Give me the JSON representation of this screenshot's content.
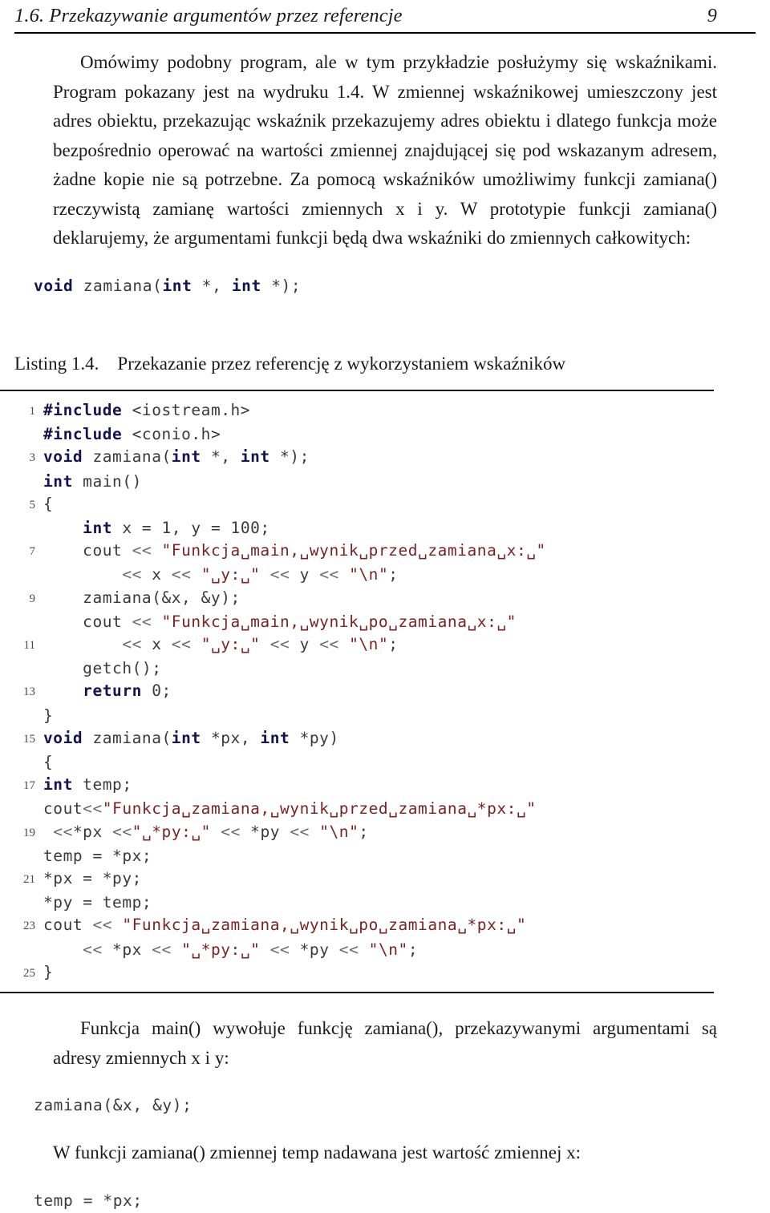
{
  "header": {
    "title": "1.6. Przekazywanie argumentów przez referencje",
    "page_number": "9"
  },
  "paragraphs": {
    "intro": "Omówimy podobny program, ale w tym przykładzie posłużymy się wskaźnikami. Program pokazany jest na wydruku 1.4. W zmiennej wskaźnikowej umieszczony jest adres obiektu, przekazując wskaźnik przekazujemy adres obiektu i dlatego funkcja może bezpośrednio operować na wartości zmiennej znajdującej się pod wskazanym adresem, żadne kopie nie są potrzebne. Za pomocą wskaźników umożliwimy funkcji zamiana() rzeczywistą zamianę wartości zmiennych x i y. W prototypie funkcji zamiana() deklarujemy, że argumentami funkcji będą dwa wskaźniki do zmiennych całkowitych:",
    "after_listing": "Funkcja main() wywołuje funkcję zamiana(), przekazywanymi argumentami są adresy zmiennych x i y:",
    "temp_note": "W funkcji zamiana() zmiennej temp nadawana jest wartość zmiennej x:"
  },
  "snippets": {
    "prototype": {
      "kw1": "void",
      "name": " zamiana(",
      "kw2": "int",
      "mid": " *, ",
      "kw3": "int",
      "end": " *);"
    },
    "call_zamiana": "zamiana(&x, &y);",
    "temp_assign": "temp = *px;"
  },
  "listing": {
    "caption_label": "Listing 1.4.",
    "caption_text": "Przekazanie przez referencję z wykorzystaniem wskaźników",
    "lines": [
      {
        "n": "1",
        "tokens": [
          {
            "t": "kw",
            "v": "#include"
          },
          {
            "t": "pln",
            "v": " <iostream.h>"
          }
        ]
      },
      {
        "n": "",
        "tokens": [
          {
            "t": "kw",
            "v": "#include"
          },
          {
            "t": "pln",
            "v": " <conio.h>"
          }
        ]
      },
      {
        "n": "3",
        "tokens": [
          {
            "t": "kw",
            "v": "void"
          },
          {
            "t": "pln",
            "v": " zamiana("
          },
          {
            "t": "kw",
            "v": "int"
          },
          {
            "t": "pln",
            "v": " *, "
          },
          {
            "t": "kw",
            "v": "int"
          },
          {
            "t": "pln",
            "v": " *);"
          }
        ]
      },
      {
        "n": "",
        "tokens": [
          {
            "t": "kw",
            "v": "int"
          },
          {
            "t": "pln",
            "v": " main()"
          }
        ]
      },
      {
        "n": "5",
        "tokens": [
          {
            "t": "pln",
            "v": "{"
          }
        ]
      },
      {
        "n": "",
        "tokens": [
          {
            "t": "pln",
            "v": "    "
          },
          {
            "t": "kw",
            "v": "int"
          },
          {
            "t": "pln",
            "v": " x = 1, y = 100;"
          }
        ]
      },
      {
        "n": "7",
        "tokens": [
          {
            "t": "pln",
            "v": "    cout "
          },
          {
            "t": "op",
            "v": "<<"
          },
          {
            "t": "pln",
            "v": " "
          },
          {
            "t": "str",
            "v": "\"Funkcja␣main,␣wynik␣przed␣zamiana␣x:␣\""
          }
        ]
      },
      {
        "n": "",
        "tokens": [
          {
            "t": "pln",
            "v": "        "
          },
          {
            "t": "op",
            "v": "<<"
          },
          {
            "t": "pln",
            "v": " x "
          },
          {
            "t": "op",
            "v": "<<"
          },
          {
            "t": "pln",
            "v": " "
          },
          {
            "t": "str",
            "v": "\"␣y:␣\""
          },
          {
            "t": "pln",
            "v": " "
          },
          {
            "t": "op",
            "v": "<<"
          },
          {
            "t": "pln",
            "v": " y "
          },
          {
            "t": "op",
            "v": "<<"
          },
          {
            "t": "pln",
            "v": " "
          },
          {
            "t": "str",
            "v": "\"\\n\""
          },
          {
            "t": "pln",
            "v": ";"
          }
        ]
      },
      {
        "n": "9",
        "tokens": [
          {
            "t": "pln",
            "v": "    zamiana(&x, &y);"
          }
        ]
      },
      {
        "n": "",
        "tokens": [
          {
            "t": "pln",
            "v": "    cout "
          },
          {
            "t": "op",
            "v": "<<"
          },
          {
            "t": "pln",
            "v": " "
          },
          {
            "t": "str",
            "v": "\"Funkcja␣main,␣wynik␣po␣zamiana␣x:␣\""
          }
        ]
      },
      {
        "n": "11",
        "tokens": [
          {
            "t": "pln",
            "v": "        "
          },
          {
            "t": "op",
            "v": "<<"
          },
          {
            "t": "pln",
            "v": " x "
          },
          {
            "t": "op",
            "v": "<<"
          },
          {
            "t": "pln",
            "v": " "
          },
          {
            "t": "str",
            "v": "\"␣y:␣\""
          },
          {
            "t": "pln",
            "v": " "
          },
          {
            "t": "op",
            "v": "<<"
          },
          {
            "t": "pln",
            "v": " y "
          },
          {
            "t": "op",
            "v": "<<"
          },
          {
            "t": "pln",
            "v": " "
          },
          {
            "t": "str",
            "v": "\"\\n\""
          },
          {
            "t": "pln",
            "v": ";"
          }
        ]
      },
      {
        "n": "",
        "tokens": [
          {
            "t": "pln",
            "v": "    getch();"
          }
        ]
      },
      {
        "n": "13",
        "tokens": [
          {
            "t": "pln",
            "v": "    "
          },
          {
            "t": "kw",
            "v": "return"
          },
          {
            "t": "pln",
            "v": " 0;"
          }
        ]
      },
      {
        "n": "",
        "tokens": [
          {
            "t": "pln",
            "v": "}"
          }
        ]
      },
      {
        "n": "15",
        "tokens": [
          {
            "t": "kw",
            "v": "void"
          },
          {
            "t": "pln",
            "v": " zamiana("
          },
          {
            "t": "kw",
            "v": "int"
          },
          {
            "t": "pln",
            "v": " *px, "
          },
          {
            "t": "kw",
            "v": "int"
          },
          {
            "t": "pln",
            "v": " *py)"
          }
        ]
      },
      {
        "n": "",
        "tokens": [
          {
            "t": "pln",
            "v": "{"
          }
        ]
      },
      {
        "n": "17",
        "tokens": [
          {
            "t": "kw",
            "v": "int"
          },
          {
            "t": "pln",
            "v": " temp;"
          }
        ]
      },
      {
        "n": "",
        "tokens": [
          {
            "t": "pln",
            "v": "cout"
          },
          {
            "t": "op",
            "v": "<<"
          },
          {
            "t": "str",
            "v": "\"Funkcja␣zamiana,␣wynik␣przed␣zamiana␣*px:␣\""
          }
        ]
      },
      {
        "n": "19",
        "tokens": [
          {
            "t": "pln",
            "v": " "
          },
          {
            "t": "op",
            "v": "<<"
          },
          {
            "t": "pln",
            "v": "*px "
          },
          {
            "t": "op",
            "v": "<<"
          },
          {
            "t": "str",
            "v": "\"␣*py:␣\""
          },
          {
            "t": "pln",
            "v": " "
          },
          {
            "t": "op",
            "v": "<<"
          },
          {
            "t": "pln",
            "v": " *py "
          },
          {
            "t": "op",
            "v": "<<"
          },
          {
            "t": "pln",
            "v": " "
          },
          {
            "t": "str",
            "v": "\"\\n\""
          },
          {
            "t": "pln",
            "v": ";"
          }
        ]
      },
      {
        "n": "",
        "tokens": [
          {
            "t": "pln",
            "v": "temp = *px;"
          }
        ]
      },
      {
        "n": "21",
        "tokens": [
          {
            "t": "pln",
            "v": "*px = *py;"
          }
        ]
      },
      {
        "n": "",
        "tokens": [
          {
            "t": "pln",
            "v": "*py = temp;"
          }
        ]
      },
      {
        "n": "23",
        "tokens": [
          {
            "t": "pln",
            "v": "cout "
          },
          {
            "t": "op",
            "v": "<<"
          },
          {
            "t": "pln",
            "v": " "
          },
          {
            "t": "str",
            "v": "\"Funkcja␣zamiana,␣wynik␣po␣zamiana␣*px:␣\""
          }
        ]
      },
      {
        "n": "",
        "tokens": [
          {
            "t": "pln",
            "v": "    "
          },
          {
            "t": "op",
            "v": "<<"
          },
          {
            "t": "pln",
            "v": " *px "
          },
          {
            "t": "op",
            "v": "<<"
          },
          {
            "t": "pln",
            "v": " "
          },
          {
            "t": "str",
            "v": "\"␣*py:␣\""
          },
          {
            "t": "pln",
            "v": " "
          },
          {
            "t": "op",
            "v": "<<"
          },
          {
            "t": "pln",
            "v": " *py "
          },
          {
            "t": "op",
            "v": "<<"
          },
          {
            "t": "pln",
            "v": " "
          },
          {
            "t": "str",
            "v": "\"\\n\""
          },
          {
            "t": "pln",
            "v": ";"
          }
        ]
      },
      {
        "n": "25",
        "tokens": [
          {
            "t": "pln",
            "v": "}"
          }
        ]
      }
    ]
  },
  "colors": {
    "keyword": "#141452",
    "string": "#7a2323",
    "plain": "#3a3a3a",
    "operator": "#6d6d6d",
    "rule": "#101010",
    "text": "#1a1a1a"
  }
}
